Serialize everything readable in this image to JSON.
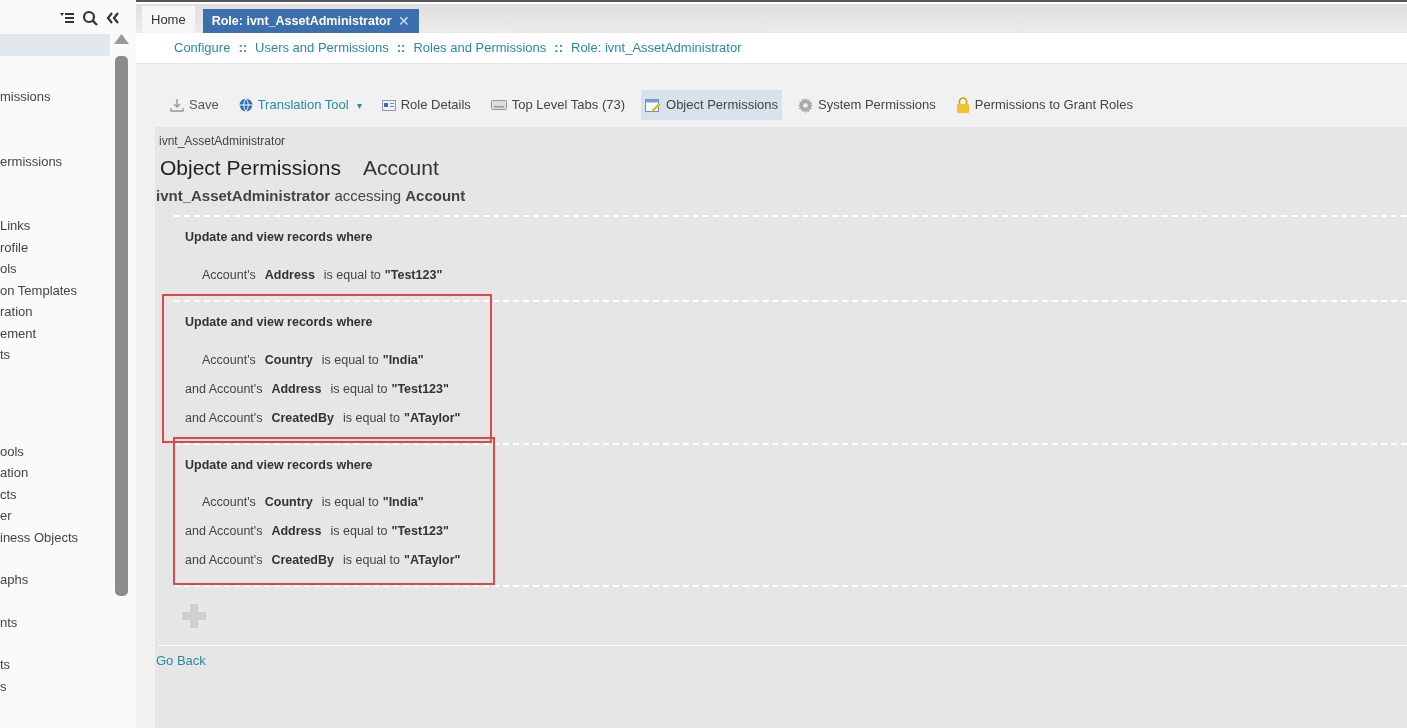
{
  "sidebar": {
    "sections": [
      {
        "items": [
          "missions"
        ]
      },
      {
        "items": [
          "ermissions"
        ]
      },
      {
        "items": [
          "Links",
          "rofile",
          "ols",
          "on Templates",
          "ration",
          "ement",
          "ts"
        ]
      },
      {
        "items": [
          "ools",
          "ation",
          "cts",
          "er",
          "iness Objects"
        ]
      },
      {
        "items": [
          "aphs"
        ]
      },
      {
        "items": [
          "nts"
        ]
      },
      {
        "items": [
          "ts",
          "s"
        ]
      }
    ]
  },
  "tabs": [
    {
      "label": "Home",
      "selected": false,
      "closable": false
    },
    {
      "label": "Role: ivnt_AssetAdministrator",
      "selected": true,
      "closable": true,
      "close": "✕"
    }
  ],
  "breadcrumb": [
    "Configure",
    "Users and Permissions",
    "Roles and Permissions",
    "Role: ivnt_AssetAdministrator"
  ],
  "breadcrumb_separator": "::",
  "toolbar": [
    {
      "kind": "save",
      "label": "Save",
      "selected": false
    },
    {
      "kind": "translate",
      "label": "Translation Tool",
      "selected": false,
      "dropdown": "▾"
    },
    {
      "kind": "card",
      "label": "Role Details",
      "selected": false
    },
    {
      "kind": "keyboard",
      "label": "Top Level Tabs (73)",
      "selected": false
    },
    {
      "kind": "edit",
      "label": "Object Permissions",
      "selected": true
    },
    {
      "kind": "gear",
      "label": "System Permissions",
      "selected": false
    },
    {
      "kind": "lock",
      "label": "Permissions to Grant Roles",
      "selected": false
    }
  ],
  "role_name": "ivnt_AssetAdministrator",
  "page_title": "Object Permissions",
  "page_subtitle": "Account",
  "summary": "**ivnt_AssetAdministrator** accessing **Account**",
  "rules": [
    {
      "heading": "Update and view records where",
      "highlighted": false,
      "conditions": [
        {
          "prefix": "Account's",
          "field": "Address",
          "operator": "is equal to",
          "value": "\"Test123\""
        }
      ]
    },
    {
      "heading": "Update and view records where",
      "highlighted": true,
      "conditions": [
        {
          "prefix": "Account's",
          "field": "Country",
          "operator": "is equal to",
          "value": "\"India\""
        },
        {
          "prefix": "and Account's",
          "field": "Address",
          "operator": "is equal to",
          "value": "\"Test123\""
        },
        {
          "prefix": "and Account's",
          "field": "CreatedBy",
          "operator": "is equal to",
          "value": "\"ATaylor\""
        }
      ]
    },
    {
      "heading": "Update and view records where",
      "highlighted": true,
      "conditions": [
        {
          "prefix": "Account's",
          "field": "Country",
          "operator": "is equal to",
          "value": "\"India\""
        },
        {
          "prefix": "and Account's",
          "field": "Address",
          "operator": "is equal to",
          "value": "\"Test123\""
        },
        {
          "prefix": "and Account's",
          "field": "CreatedBy",
          "operator": "is equal to",
          "value": "\"ATaylor\""
        }
      ]
    }
  ],
  "go_back": "Go Back"
}
